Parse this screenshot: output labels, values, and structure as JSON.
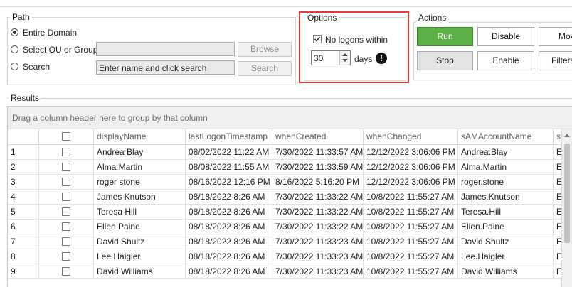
{
  "path": {
    "title": "Path",
    "entire_domain": "Entire Domain",
    "select_ou": "Select OU or Group",
    "search": "Search",
    "ou_value": "",
    "search_value": "Enter name and click search",
    "browse": "Browse",
    "search_btn": "Search"
  },
  "options": {
    "title": "Options",
    "no_logons_label": "No logons within",
    "days_value": "30",
    "days_label": "days",
    "highlight_color": "#e03a3a"
  },
  "actions": {
    "title": "Actions",
    "run": "Run",
    "disable": "Disable",
    "move": "Mov",
    "stop": "Stop",
    "enable": "Enable",
    "filters": "Filters"
  },
  "results": {
    "title": "Results",
    "group_hint": "Drag a column header here to group by that column",
    "columns": [
      "displayName",
      "lastLogonTimestamp",
      "whenCreated",
      "whenChanged",
      "sAMAccountName",
      "statu"
    ],
    "rows": [
      {
        "n": "1",
        "displayName": "Andrea Blay",
        "lastLogon": "08/02/2022 11:22 AM",
        "whenCreated": "7/30/2022 11:33:57 AM",
        "whenChanged": "12/12/2022 3:06:06 PM",
        "sam": "Andrea.Blay",
        "status": "Enab"
      },
      {
        "n": "2",
        "displayName": "Alma Martin",
        "lastLogon": "08/08/2022 11:55 AM",
        "whenCreated": "7/30/2022 11:33:59 AM",
        "whenChanged": "12/12/2022 3:06:06 PM",
        "sam": "Alma.Martin",
        "status": "Enab"
      },
      {
        "n": "3",
        "displayName": "roger stone",
        "lastLogon": "08/16/2022 12:16 PM",
        "whenCreated": "8/16/2022 5:16:20 PM",
        "whenChanged": "12/12/2022 3:06:06 PM",
        "sam": "roger.stone",
        "status": "Enab"
      },
      {
        "n": "4",
        "displayName": "James Knutson",
        "lastLogon": "08/18/2022 8:26 AM",
        "whenCreated": "7/30/2022 11:33:22 AM",
        "whenChanged": "10/8/2022 11:55:27 AM",
        "sam": "James.Knutson",
        "status": "Enab"
      },
      {
        "n": "5",
        "displayName": "Teresa Hill",
        "lastLogon": "08/18/2022 8:26 AM",
        "whenCreated": "7/30/2022 11:33:22 AM",
        "whenChanged": "10/8/2022 11:55:27 AM",
        "sam": "Teresa.Hill",
        "status": "Enab"
      },
      {
        "n": "6",
        "displayName": "Ellen Paine",
        "lastLogon": "08/18/2022 8:26 AM",
        "whenCreated": "7/30/2022 11:33:22 AM",
        "whenChanged": "10/8/2022 11:55:27 AM",
        "sam": "Ellen.Paine",
        "status": "Enab"
      },
      {
        "n": "7",
        "displayName": "David Shultz",
        "lastLogon": "08/18/2022 8:26 AM",
        "whenCreated": "7/30/2022 11:33:23 AM",
        "whenChanged": "10/8/2022 11:55:27 AM",
        "sam": "David.Shultz",
        "status": "Enab"
      },
      {
        "n": "8",
        "displayName": "Lee Haigler",
        "lastLogon": "08/18/2022 8:26 AM",
        "whenCreated": "7/30/2022 11:33:23 AM",
        "whenChanged": "10/8/2022 11:55:27 AM",
        "sam": "Lee.Haigler",
        "status": "Enab"
      },
      {
        "n": "9",
        "displayName": "David Williams",
        "lastLogon": "08/18/2022 8:26 AM",
        "whenCreated": "7/30/2022 11:33:23 AM",
        "whenChanged": "10/8/2022 11:55:27 AM",
        "sam": "David.Williams",
        "status": "Enab"
      }
    ]
  }
}
